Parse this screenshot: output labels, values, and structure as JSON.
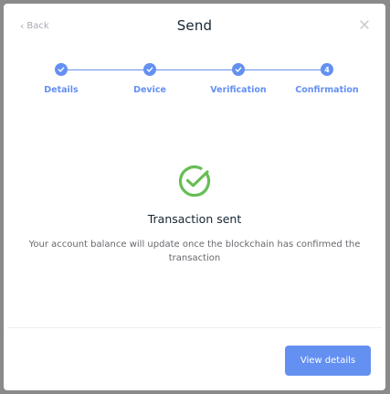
{
  "header": {
    "back_label": "Back",
    "title": "Send"
  },
  "stepper": {
    "steps": [
      {
        "label": "Details",
        "state": "done"
      },
      {
        "label": "Device",
        "state": "done"
      },
      {
        "label": "Verification",
        "state": "done"
      },
      {
        "label": "Confirmation",
        "state": "current",
        "number": "4"
      }
    ]
  },
  "result": {
    "icon": "check-circle-icon",
    "heading": "Transaction sent",
    "description": "Your account balance will update once the blockchain has confirmed the transaction"
  },
  "footer": {
    "view_details_label": "View details"
  },
  "colors": {
    "accent": "#6490f1",
    "success": "#66be54",
    "text_primary": "#142533",
    "text_secondary": "#67686d",
    "muted": "#a7a9b3"
  }
}
